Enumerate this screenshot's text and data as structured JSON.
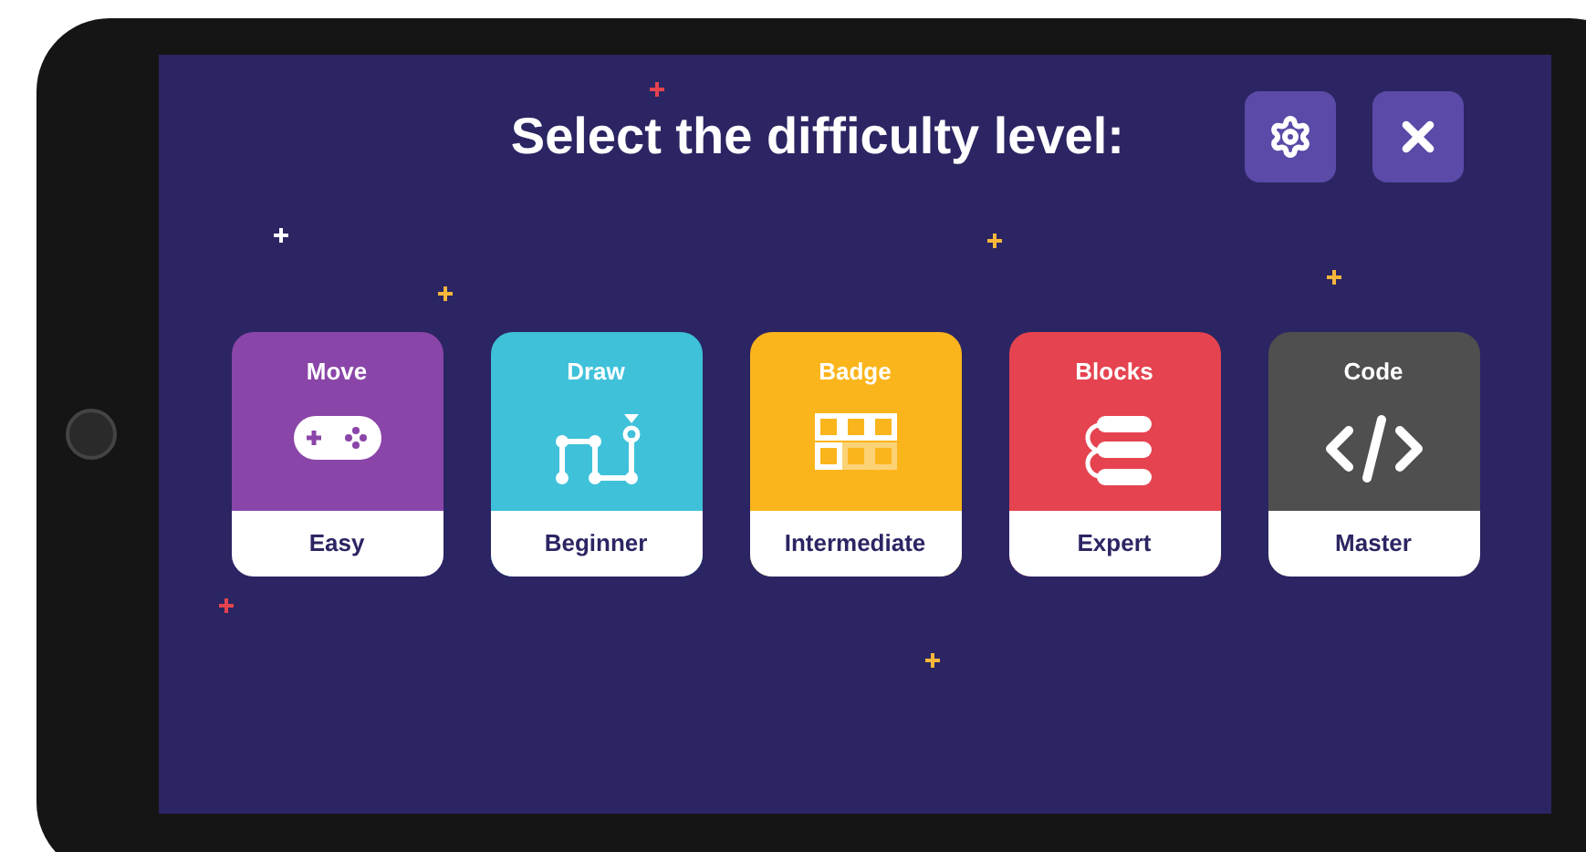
{
  "title": "Select the difficulty level:",
  "levels": [
    {
      "kind": "gamepad",
      "category": "Move",
      "level_name": "Easy",
      "color": "#8a45a8"
    },
    {
      "kind": "path",
      "category": "Draw",
      "level_name": "Beginner",
      "color": "#3fc1da"
    },
    {
      "kind": "grid",
      "category": "Badge",
      "level_name": "Intermediate",
      "color": "#fbb51c"
    },
    {
      "kind": "blocks",
      "category": "Blocks",
      "level_name": "Expert",
      "color": "#e5434f"
    },
    {
      "kind": "code",
      "category": "Code",
      "level_name": "Master",
      "color": "#4f4f4f"
    }
  ]
}
